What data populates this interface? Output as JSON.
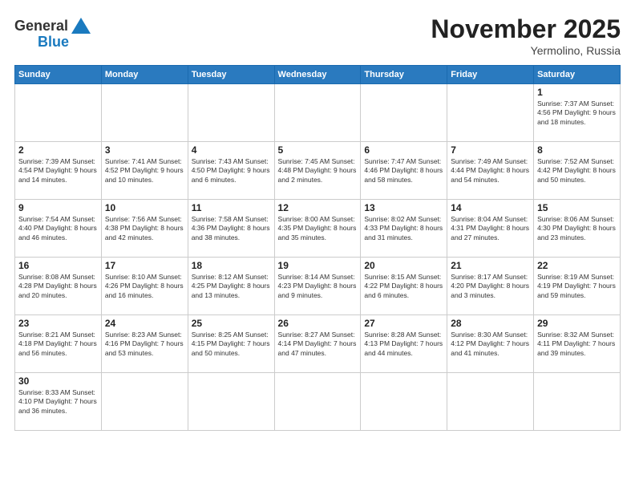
{
  "header": {
    "logo_line1": "General",
    "logo_line2": "Blue",
    "title": "November 2025",
    "location": "Yermolino, Russia"
  },
  "weekdays": [
    "Sunday",
    "Monday",
    "Tuesday",
    "Wednesday",
    "Thursday",
    "Friday",
    "Saturday"
  ],
  "weeks": [
    [
      {
        "day": "",
        "info": ""
      },
      {
        "day": "",
        "info": ""
      },
      {
        "day": "",
        "info": ""
      },
      {
        "day": "",
        "info": ""
      },
      {
        "day": "",
        "info": ""
      },
      {
        "day": "",
        "info": ""
      },
      {
        "day": "1",
        "info": "Sunrise: 7:37 AM\nSunset: 4:56 PM\nDaylight: 9 hours\nand 18 minutes."
      }
    ],
    [
      {
        "day": "2",
        "info": "Sunrise: 7:39 AM\nSunset: 4:54 PM\nDaylight: 9 hours\nand 14 minutes."
      },
      {
        "day": "3",
        "info": "Sunrise: 7:41 AM\nSunset: 4:52 PM\nDaylight: 9 hours\nand 10 minutes."
      },
      {
        "day": "4",
        "info": "Sunrise: 7:43 AM\nSunset: 4:50 PM\nDaylight: 9 hours\nand 6 minutes."
      },
      {
        "day": "5",
        "info": "Sunrise: 7:45 AM\nSunset: 4:48 PM\nDaylight: 9 hours\nand 2 minutes."
      },
      {
        "day": "6",
        "info": "Sunrise: 7:47 AM\nSunset: 4:46 PM\nDaylight: 8 hours\nand 58 minutes."
      },
      {
        "day": "7",
        "info": "Sunrise: 7:49 AM\nSunset: 4:44 PM\nDaylight: 8 hours\nand 54 minutes."
      },
      {
        "day": "8",
        "info": "Sunrise: 7:52 AM\nSunset: 4:42 PM\nDaylight: 8 hours\nand 50 minutes."
      }
    ],
    [
      {
        "day": "9",
        "info": "Sunrise: 7:54 AM\nSunset: 4:40 PM\nDaylight: 8 hours\nand 46 minutes."
      },
      {
        "day": "10",
        "info": "Sunrise: 7:56 AM\nSunset: 4:38 PM\nDaylight: 8 hours\nand 42 minutes."
      },
      {
        "day": "11",
        "info": "Sunrise: 7:58 AM\nSunset: 4:36 PM\nDaylight: 8 hours\nand 38 minutes."
      },
      {
        "day": "12",
        "info": "Sunrise: 8:00 AM\nSunset: 4:35 PM\nDaylight: 8 hours\nand 35 minutes."
      },
      {
        "day": "13",
        "info": "Sunrise: 8:02 AM\nSunset: 4:33 PM\nDaylight: 8 hours\nand 31 minutes."
      },
      {
        "day": "14",
        "info": "Sunrise: 8:04 AM\nSunset: 4:31 PM\nDaylight: 8 hours\nand 27 minutes."
      },
      {
        "day": "15",
        "info": "Sunrise: 8:06 AM\nSunset: 4:30 PM\nDaylight: 8 hours\nand 23 minutes."
      }
    ],
    [
      {
        "day": "16",
        "info": "Sunrise: 8:08 AM\nSunset: 4:28 PM\nDaylight: 8 hours\nand 20 minutes."
      },
      {
        "day": "17",
        "info": "Sunrise: 8:10 AM\nSunset: 4:26 PM\nDaylight: 8 hours\nand 16 minutes."
      },
      {
        "day": "18",
        "info": "Sunrise: 8:12 AM\nSunset: 4:25 PM\nDaylight: 8 hours\nand 13 minutes."
      },
      {
        "day": "19",
        "info": "Sunrise: 8:14 AM\nSunset: 4:23 PM\nDaylight: 8 hours\nand 9 minutes."
      },
      {
        "day": "20",
        "info": "Sunrise: 8:15 AM\nSunset: 4:22 PM\nDaylight: 8 hours\nand 6 minutes."
      },
      {
        "day": "21",
        "info": "Sunrise: 8:17 AM\nSunset: 4:20 PM\nDaylight: 8 hours\nand 3 minutes."
      },
      {
        "day": "22",
        "info": "Sunrise: 8:19 AM\nSunset: 4:19 PM\nDaylight: 7 hours\nand 59 minutes."
      }
    ],
    [
      {
        "day": "23",
        "info": "Sunrise: 8:21 AM\nSunset: 4:18 PM\nDaylight: 7 hours\nand 56 minutes."
      },
      {
        "day": "24",
        "info": "Sunrise: 8:23 AM\nSunset: 4:16 PM\nDaylight: 7 hours\nand 53 minutes."
      },
      {
        "day": "25",
        "info": "Sunrise: 8:25 AM\nSunset: 4:15 PM\nDaylight: 7 hours\nand 50 minutes."
      },
      {
        "day": "26",
        "info": "Sunrise: 8:27 AM\nSunset: 4:14 PM\nDaylight: 7 hours\nand 47 minutes."
      },
      {
        "day": "27",
        "info": "Sunrise: 8:28 AM\nSunset: 4:13 PM\nDaylight: 7 hours\nand 44 minutes."
      },
      {
        "day": "28",
        "info": "Sunrise: 8:30 AM\nSunset: 4:12 PM\nDaylight: 7 hours\nand 41 minutes."
      },
      {
        "day": "29",
        "info": "Sunrise: 8:32 AM\nSunset: 4:11 PM\nDaylight: 7 hours\nand 39 minutes."
      }
    ],
    [
      {
        "day": "30",
        "info": "Sunrise: 8:33 AM\nSunset: 4:10 PM\nDaylight: 7 hours\nand 36 minutes."
      },
      {
        "day": "",
        "info": ""
      },
      {
        "day": "",
        "info": ""
      },
      {
        "day": "",
        "info": ""
      },
      {
        "day": "",
        "info": ""
      },
      {
        "day": "",
        "info": ""
      },
      {
        "day": "",
        "info": ""
      }
    ]
  ]
}
